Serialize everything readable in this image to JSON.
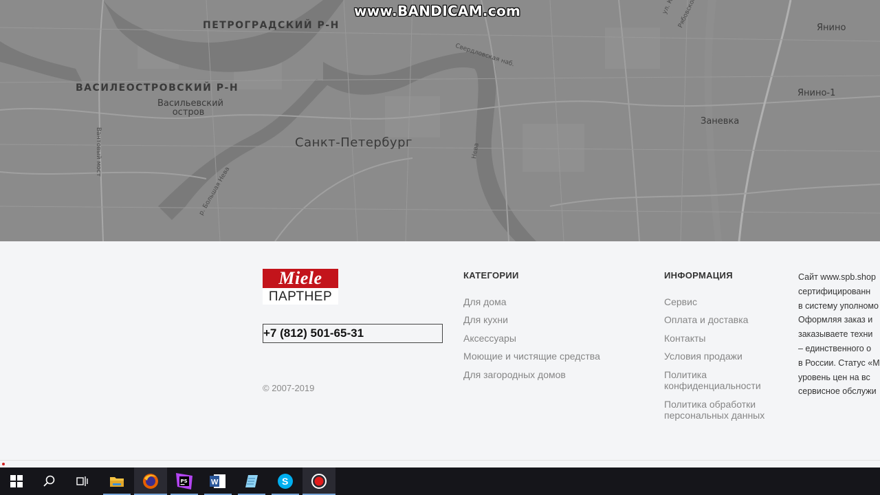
{
  "watermark": "www.BANDICAM.com",
  "map": {
    "districts": {
      "petrogradsky": "ПЕТРОГРАДСКИЙ Р-Н",
      "vasileostrovsky": "ВАСИЛЕОСТРОВСКИЙ Р-Н"
    },
    "places": {
      "vasilyevsky_1": "Васильевский",
      "vasilyevsky_2": "остров",
      "city": "Санкт-Петербург",
      "yanino": "Янино",
      "yanino1": "Янино-1",
      "zanevka": "Заневка"
    },
    "streets": {
      "sverdlovskaya": "Свердловская наб.",
      "neva": "Нева",
      "bolshaya_neva": "р. Большая Нева",
      "vantovy": "Вантовый мост",
      "ryabovskoe": "Рябовское",
      "ul_k": "ул. К"
    }
  },
  "footer": {
    "logo_brand": "Miele",
    "logo_partner": "ПАРТНЕР",
    "phone": "+7 (812) 501-65-31",
    "copyright": "© 2007-2019",
    "categories": {
      "title": "КАТЕГОРИИ",
      "items": [
        "Для дома",
        "Для кухни",
        "Аксессуары",
        "Моющие и чистящие средства",
        "Для загородных домов"
      ]
    },
    "info": {
      "title": "ИНФОРМАЦИЯ",
      "items": [
        "Сервис",
        "Оплата и доставка",
        "Контакты",
        "Условия продажи"
      ],
      "privacy_1": "Политика",
      "privacy_2": "конфиденциальности",
      "personal_1": "Политика обработки",
      "personal_2": "персональных данных"
    },
    "about_lines": [
      "Сайт www.spb.shop",
      "сертифицированн",
      "в систему уполномо",
      "Оформляя заказ и",
      "заказываете техни",
      "– единственного о",
      "в России. Статус «М",
      "уровень цен на вс",
      "сервисное обслужи"
    ]
  },
  "taskbar": {
    "items": [
      "start-button",
      "search-button",
      "task-view-button",
      "file-explorer",
      "firefox",
      "phpstorm",
      "word",
      "notepad",
      "skype",
      "bandicam"
    ]
  }
}
